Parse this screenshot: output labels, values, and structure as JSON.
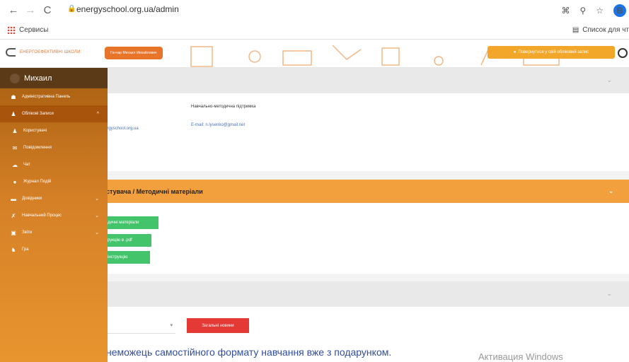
{
  "browser": {
    "url": "energyschool.org.ua/admin",
    "back": "←",
    "forward": "→",
    "reload": "C",
    "profile_initial": "B",
    "bookmarks_apps": "Сервисы",
    "reading_list": "Список для чт"
  },
  "appbar": {
    "logo_text": "ЕНЕРГОЕФЕКТИВНІ ШКОЛИ",
    "user_pill": "Гончар Михаил Михайлович",
    "return_button": "Повернутися у свій обліковий запис"
  },
  "sidebar": {
    "user_name": "Михаил",
    "items": [
      {
        "label": "Адміністративна Панель",
        "icon": "dashboard-icon"
      },
      {
        "label": "Облікові Записи",
        "icon": "user-icon"
      },
      {
        "label": "Користувачі",
        "icon": "user-icon"
      },
      {
        "label": "Повідомлення",
        "icon": "envelope-icon"
      },
      {
        "label": "Чат",
        "icon": "chat-icon"
      },
      {
        "label": "Журнал Подій",
        "icon": "circle-icon"
      },
      {
        "label": "Довідники",
        "icon": "book-icon"
      },
      {
        "label": "Навчальний Процес",
        "icon": "tools-icon"
      },
      {
        "label": "Звіти",
        "icon": "report-icon"
      },
      {
        "label": "Гра",
        "icon": "game-icon"
      }
    ]
  },
  "main": {
    "support_title": "Навчально-методична підтримка",
    "support_email": "E-mail: n.lysenko@gmail.net",
    "left_email": "ergyschool.org.ua",
    "materials_header": "стувача / Методичні матеріали",
    "green_buttons": [
      "дичні матеріали",
      "рукцію в .pdf",
      "інструкцію"
    ],
    "news_button": "Загальні новини",
    "big_text": "неможець самостійного формату навчання вже з подарунком.",
    "activation": "Активация Windows"
  },
  "colors": {
    "orange": "#f2a03e",
    "sidebar": "#d58027",
    "green": "#43c46a",
    "red": "#e53935"
  }
}
